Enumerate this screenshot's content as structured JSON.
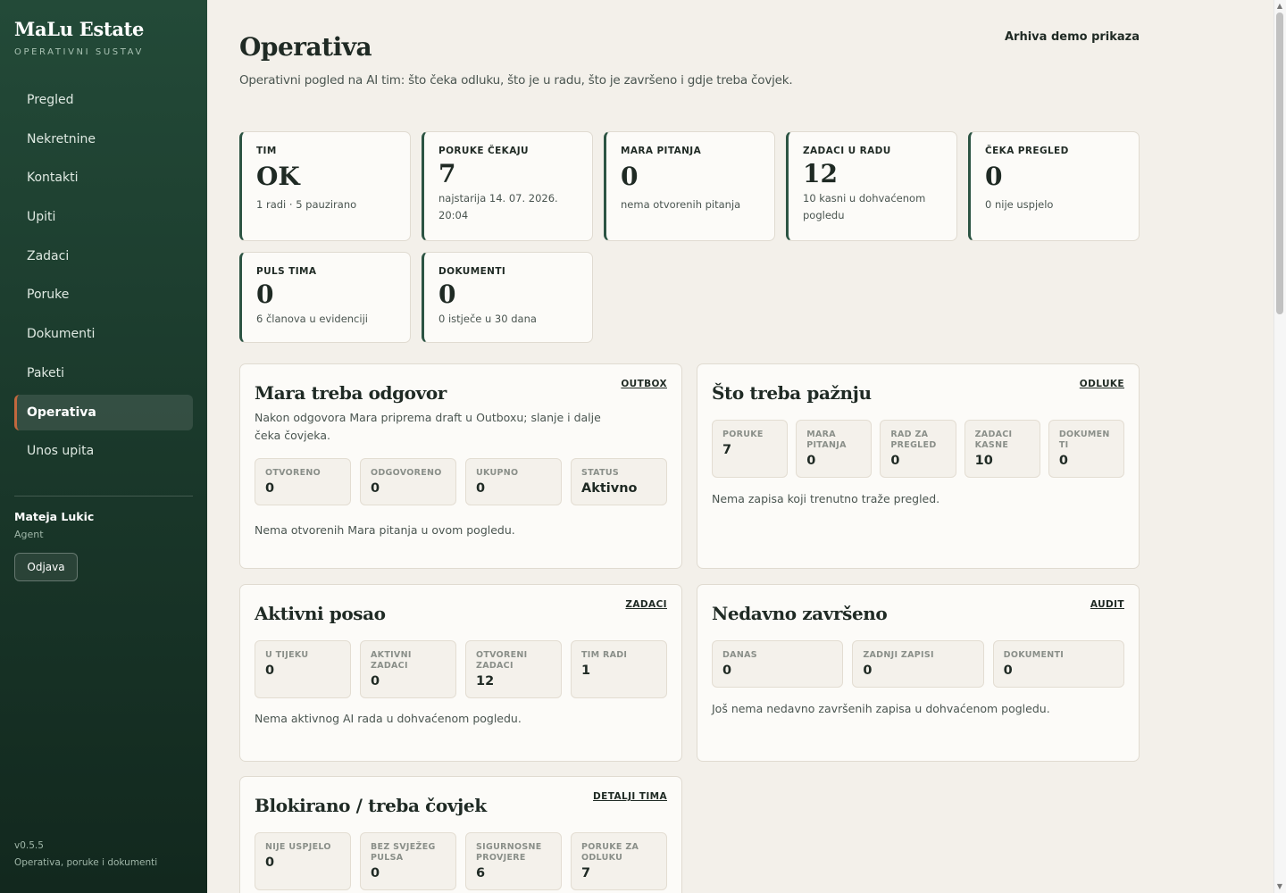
{
  "sidebar": {
    "brand_title": "MaLu Estate",
    "brand_subtitle": "OPERATIVNI SUSTAV",
    "nav": [
      "Pregled",
      "Nekretnine",
      "Kontakti",
      "Upiti",
      "Zadaci",
      "Poruke",
      "Dokumenti",
      "Paketi",
      "Operativa",
      "Unos upita"
    ],
    "active_item": "Operativa",
    "user_name": "Mateja Lukic",
    "user_role": "Agent",
    "logout_label": "Odjava",
    "version": "v0.5.5",
    "footer_note": "Operativa, poruke i dokumenti"
  },
  "header": {
    "title": "Operativa",
    "archive_link": "Arhiva demo prikaza",
    "description": "Operativni pogled na AI tim: što čeka odluku, što je u radu, što je završeno i gdje treba čovjek."
  },
  "stats": [
    {
      "label": "TIM",
      "value": "OK",
      "sub": "1 radi · 5 pauzirano"
    },
    {
      "label": "PORUKE ČEKAJU",
      "value": "7",
      "sub": "najstarija 14. 07. 2026. 20:04"
    },
    {
      "label": "MARA PITANJA",
      "value": "0",
      "sub": "nema otvorenih pitanja"
    },
    {
      "label": "ZADACI U RADU",
      "value": "12",
      "sub": "10 kasni u dohvaćenom pogledu"
    },
    {
      "label": "ČEKA PREGLED",
      "value": "0",
      "sub": "0 nije uspjelo"
    },
    {
      "label": "PULS TIMA",
      "value": "0",
      "sub": "6 članova u evidenciji"
    },
    {
      "label": "DOKUMENTI",
      "value": "0",
      "sub": "0 istječe u 30 dana"
    }
  ],
  "panels": {
    "mara": {
      "title": "Mara treba odgovor",
      "link": "OUTBOX",
      "description": "Nakon odgovora Mara priprema draft u Outboxu; slanje i dalje čeka čovjeka.",
      "metrics": [
        {
          "label": "OTVORENO",
          "value": "0"
        },
        {
          "label": "ODGOVORENO",
          "value": "0"
        },
        {
          "label": "UKUPNO",
          "value": "0"
        },
        {
          "label": "STATUS",
          "value": "Aktivno"
        }
      ],
      "note": "Nema otvorenih Mara pitanja u ovom pogledu."
    },
    "attention": {
      "title": "Što treba pažnju",
      "link": "ODLUKE",
      "metrics": [
        {
          "label": "PORUKE",
          "value": "7"
        },
        {
          "label": "MARA PITANJA",
          "value": "0"
        },
        {
          "label": "RAD ZA PREGLED",
          "value": "0"
        },
        {
          "label": "ZADACI KASNE",
          "value": "10"
        },
        {
          "label": "DOKUMENTI",
          "value": "0"
        }
      ],
      "note": "Nema zapisa koji trenutno traže pregled."
    },
    "active": {
      "title": "Aktivni posao",
      "link": "ZADACI",
      "metrics": [
        {
          "label": "U TIJEKU",
          "value": "0"
        },
        {
          "label": "AKTIVNI ZADACI",
          "value": "0"
        },
        {
          "label": "OTVORENI ZADACI",
          "value": "12"
        },
        {
          "label": "TIM RADI",
          "value": "1"
        }
      ],
      "note": "Nema aktivnog AI rada u dohvaćenom pogledu."
    },
    "recent": {
      "title": "Nedavno završeno",
      "link": "AUDIT",
      "metrics": [
        {
          "label": "DANAS",
          "value": "0"
        },
        {
          "label": "ZADNJI ZAPISI",
          "value": "0"
        },
        {
          "label": "DOKUMENTI",
          "value": "0"
        }
      ],
      "note": "Još nema nedavno završenih zapisa u dohvaćenom pogledu."
    },
    "blocked": {
      "title": "Blokirano / treba čovjek",
      "link": "DETALJI TIMA",
      "metrics": [
        {
          "label": "NIJE USPJELO",
          "value": "0"
        },
        {
          "label": "BEZ SVJEŽEG PULSA",
          "value": "0"
        },
        {
          "label": "SIGURNOSNE PROVJERE",
          "value": "6"
        },
        {
          "label": "PORUKE ZA ODLUKU",
          "value": "7"
        }
      ]
    }
  },
  "colors": {
    "sidebar_bg": "#1b3a2c",
    "accent_border": "#2c5443",
    "active_marker": "#c2683e",
    "page_bg": "#f3f0ea"
  }
}
